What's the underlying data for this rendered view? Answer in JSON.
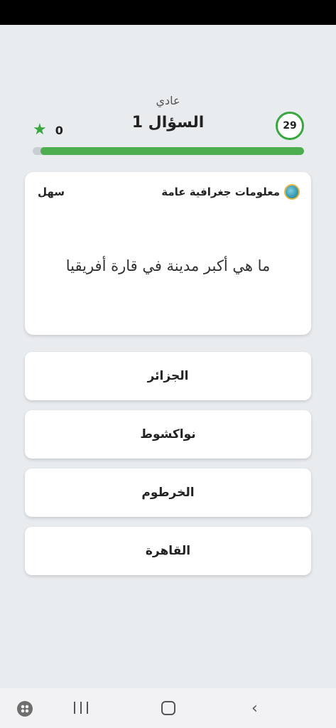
{
  "header": {
    "mode": "عادي",
    "question_title": "السؤال 1",
    "score": "0",
    "timer": "29",
    "progress_fraction": 0.97
  },
  "card": {
    "category": "معلومات جغرافية عامة",
    "difficulty": "سهل",
    "question": "ما هي أكبر مدينة في قارة أفريقيا"
  },
  "answers": [
    {
      "label": "الجزائر"
    },
    {
      "label": "نواكشوط"
    },
    {
      "label": "الخرطوم"
    },
    {
      "label": "القاهرة"
    }
  ],
  "nav": {
    "back_glyph": "‹"
  },
  "colors": {
    "accent": "#4cae4f",
    "background": "#e9ecef"
  }
}
